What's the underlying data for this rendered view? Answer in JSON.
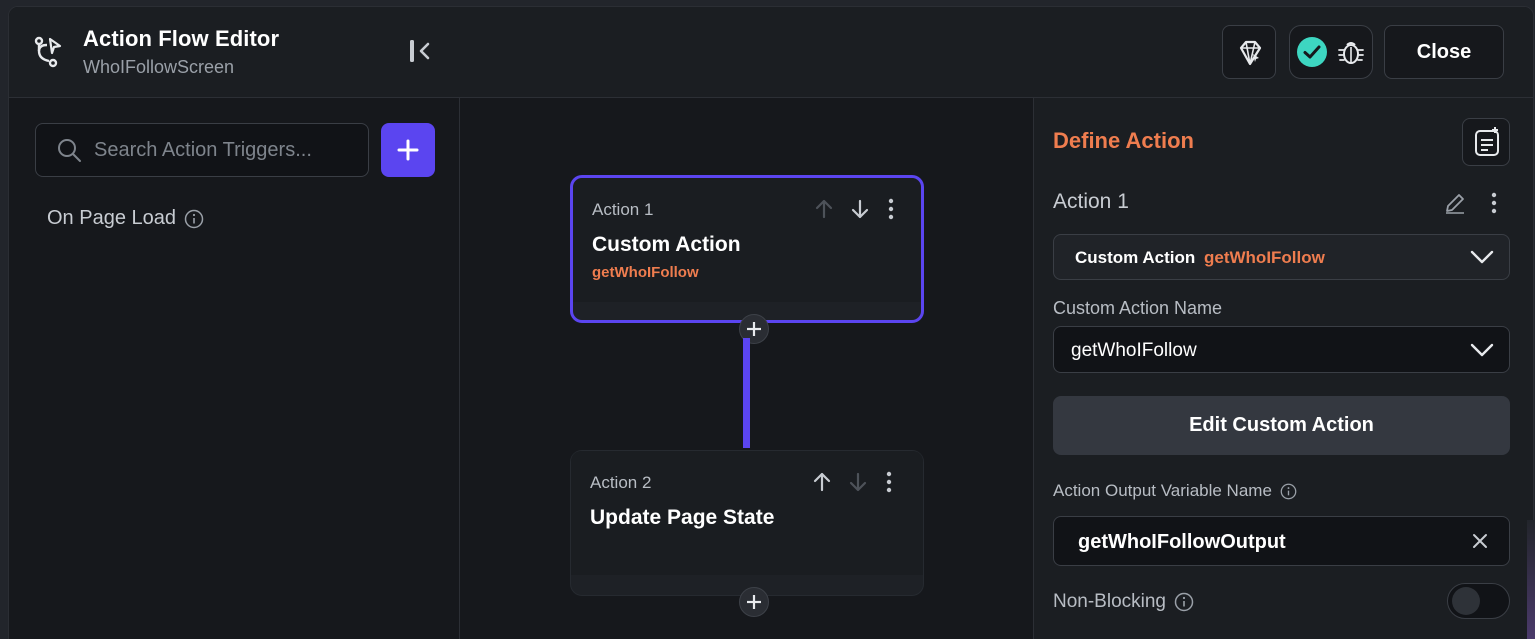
{
  "header": {
    "title": "Action Flow Editor",
    "subtitle": "WhoIFollowScreen",
    "close_label": "Close"
  },
  "sidebar": {
    "search_placeholder": "Search Action Triggers...",
    "triggers": [
      {
        "label": "On Page Load"
      }
    ]
  },
  "canvas": {
    "nodes": [
      {
        "label": "Action 1",
        "name": "Custom Action",
        "sub": "getWhoIFollow"
      },
      {
        "label": "Action 2",
        "name": "Update Page State",
        "sub": ""
      }
    ]
  },
  "panel": {
    "title": "Define Action",
    "action_title": "Action 1",
    "action_type": "Custom Action",
    "action_type_value": "getWhoIFollow",
    "custom_action_name_label": "Custom Action Name",
    "custom_action_name_value": "getWhoIFollow",
    "edit_button_label": "Edit Custom Action",
    "output_label": "Action Output Variable Name",
    "output_value": "getWhoIFollowOutput",
    "non_blocking_label": "Non-Blocking",
    "non_blocking_on": false
  },
  "colors": {
    "accent": "#5b45f0",
    "highlight": "#ef7d4f",
    "success": "#3dd6c1"
  }
}
